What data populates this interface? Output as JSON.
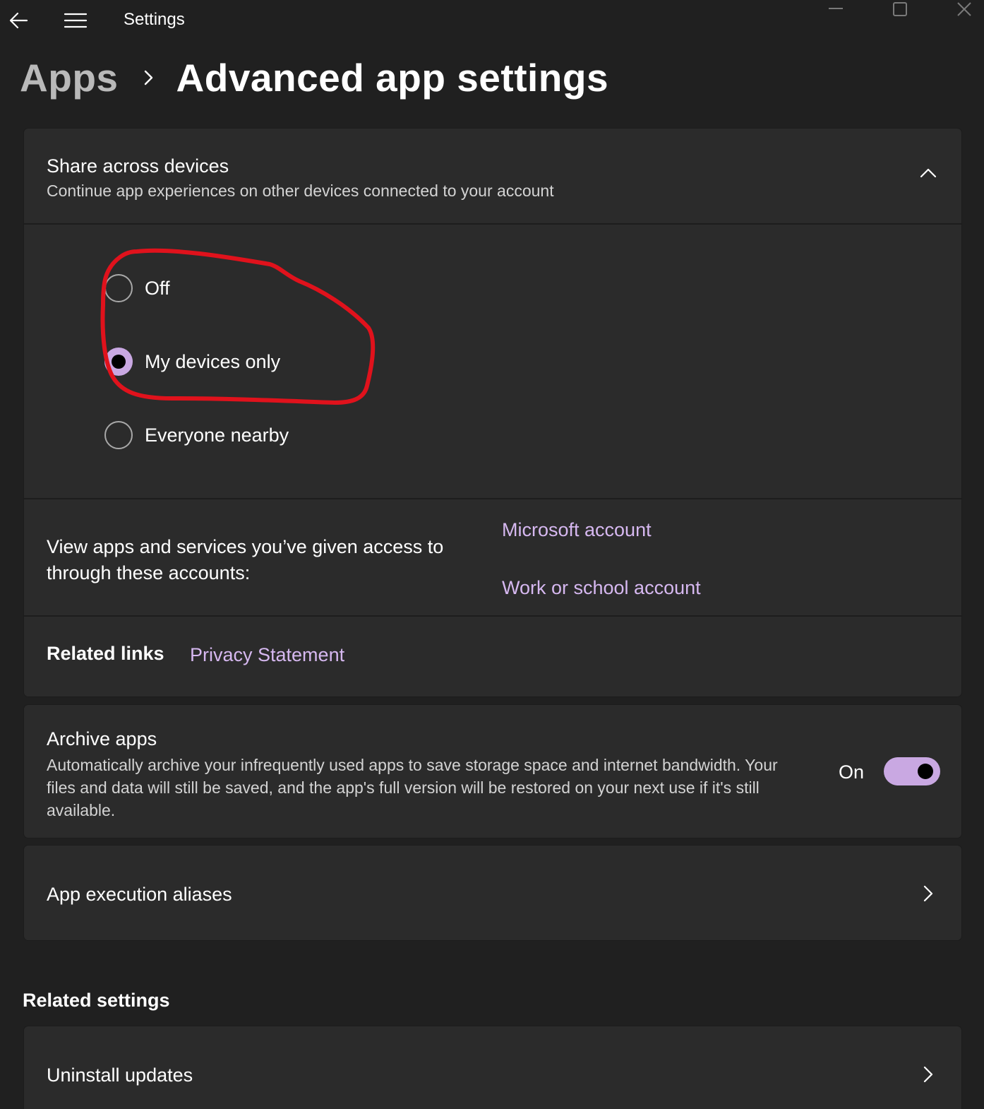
{
  "window": {
    "title": "Settings",
    "icons": {
      "back": "back-arrow-icon",
      "menu": "hamburger-menu-icon",
      "minimize": "minimize-icon",
      "maximize": "maximize-icon",
      "close": "close-icon"
    }
  },
  "breadcrumb": {
    "parent": "Apps",
    "separator_icon": "chevron-right-icon",
    "current": "Advanced app settings"
  },
  "share_across_devices": {
    "title": "Share across devices",
    "description": "Continue app experiences on other devices connected to your account",
    "expanded": true,
    "options": [
      {
        "label": "Off",
        "selected": false
      },
      {
        "label": "My devices only",
        "selected": true
      },
      {
        "label": "Everyone nearby",
        "selected": false
      }
    ],
    "annotation_color": "#e0121c",
    "accounts_text": "View apps and services you’ve given access to through these accounts:",
    "account_links": [
      "Microsoft account",
      "Work or school account"
    ],
    "related_links_label": "Related links",
    "related_links": [
      "Privacy Statement"
    ]
  },
  "archive_apps": {
    "title": "Archive apps",
    "description": "Automatically archive your infrequently used apps to save storage space and internet bandwidth. Your files and data will still be saved, and the app's full version will be restored on your next use if it's still available.",
    "toggle_state_label": "On",
    "toggle_on": true
  },
  "app_execution_aliases": {
    "label": "App execution aliases"
  },
  "related_settings": {
    "title": "Related settings",
    "items": [
      {
        "label": "Uninstall updates"
      }
    ]
  },
  "colors": {
    "background": "#202020",
    "card": "#2b2b2b",
    "accent": "#c9a8e2",
    "link": "#d6b8f0"
  }
}
